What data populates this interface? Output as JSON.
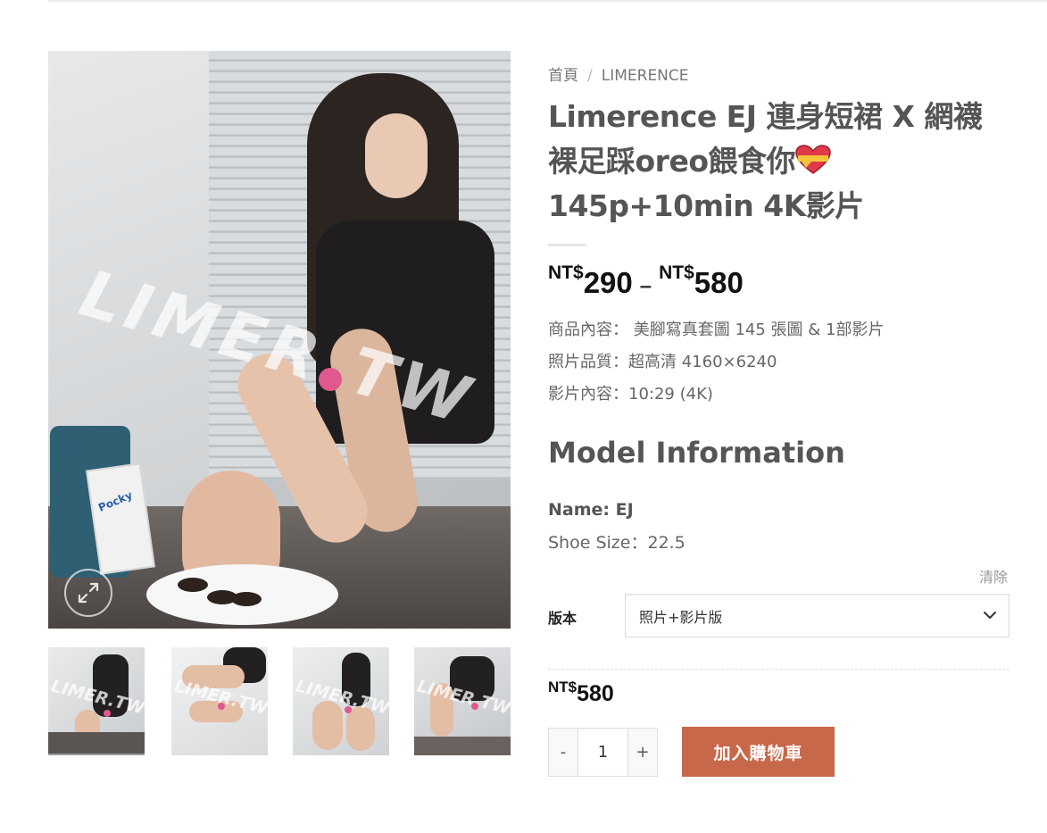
{
  "breadcrumb": {
    "home": "首頁",
    "separator": "/",
    "category": "LIMERENCE"
  },
  "product": {
    "title_line1": "Limerence EJ 連身短裙 X 網襪",
    "title_line2": "裸足踩oreo餵食你",
    "title_line3": "145p+10min 4K影片",
    "title_emoji": "heart-ribbon-emoji"
  },
  "price_range": {
    "currency": "NT$",
    "min": "290",
    "separator": "–",
    "max": "580"
  },
  "description": {
    "line1": "商品內容： 美腳寫真套圖 145 張圖 & 1部影片",
    "line2": "照片品質：超高清 4160×6240",
    "line3": "影片內容：10:29 (4K)"
  },
  "model": {
    "heading": "Model Information",
    "name_label": "Name:",
    "name_value": " EJ",
    "shoe_label": "Shoe Size：",
    "shoe_value": "22.5"
  },
  "variation": {
    "clear_label": "清除",
    "label": "版本",
    "selected": "照片+影片版"
  },
  "selected_price": {
    "currency": "NT$",
    "amount": "580"
  },
  "cart": {
    "minus": "-",
    "quantity": "1",
    "plus": "+",
    "add_label": "加入購物車"
  },
  "gallery": {
    "watermark": "LIMER.TW",
    "thumbnail_count": 4
  },
  "colors": {
    "accent_button": "#c8684a",
    "watermark_dot": "#e0588f"
  }
}
